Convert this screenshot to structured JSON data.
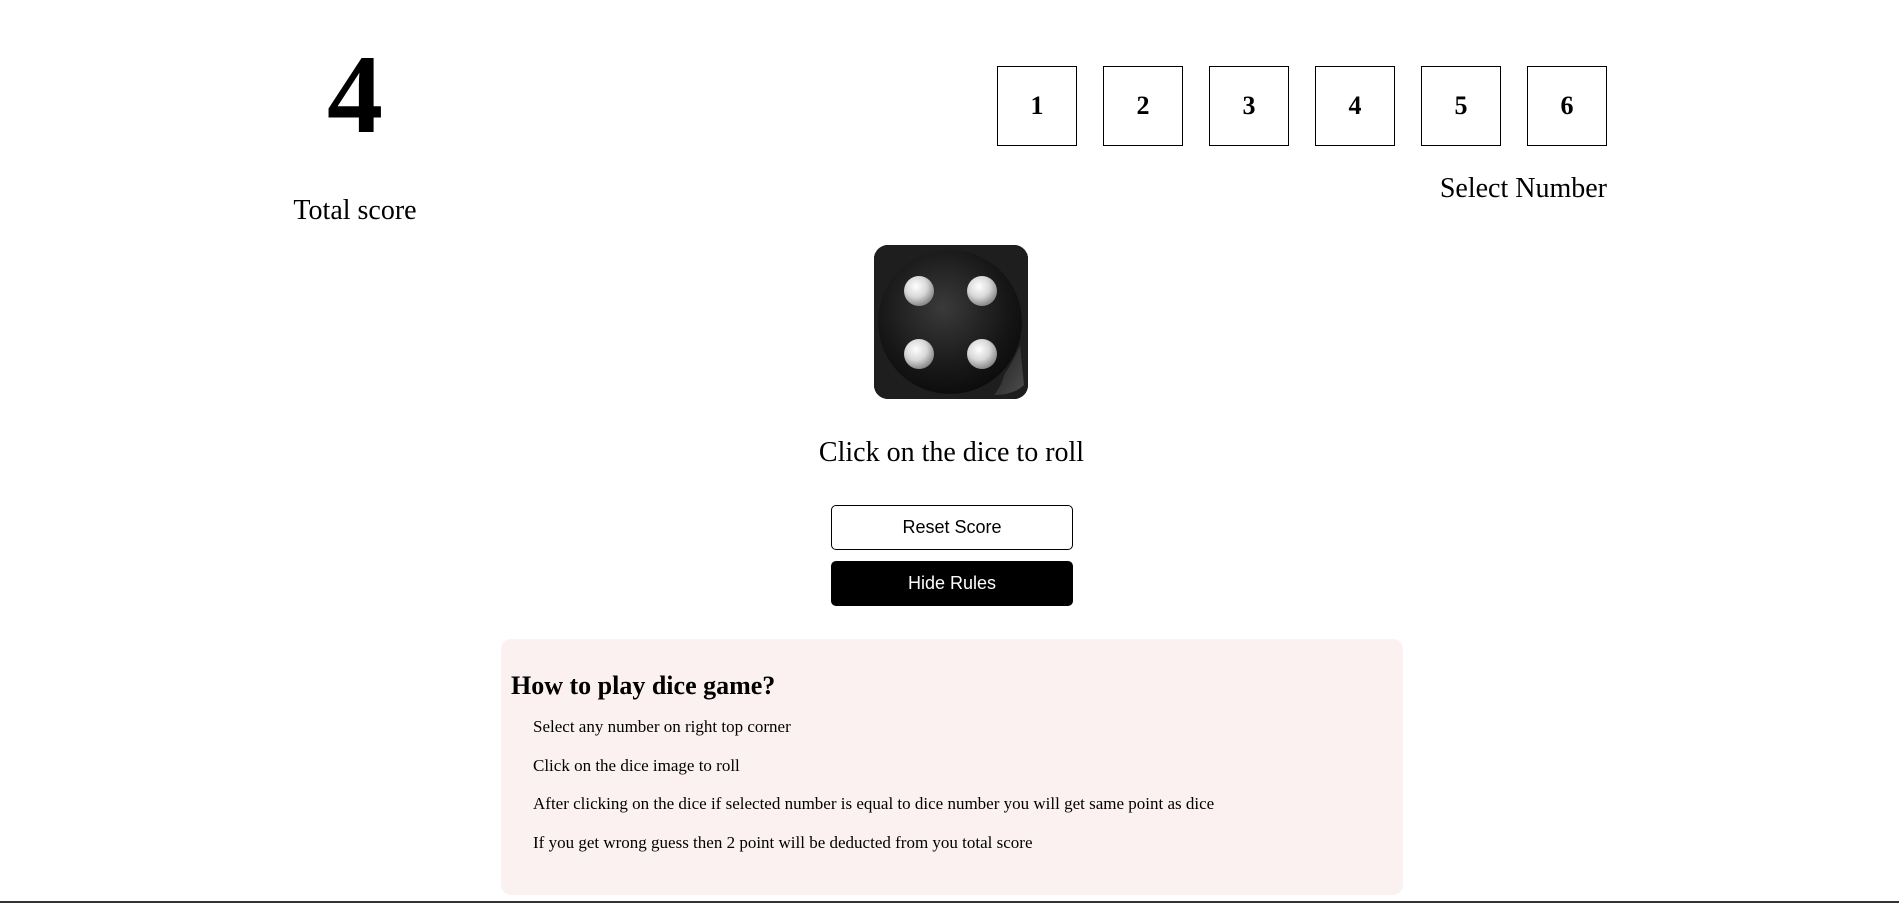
{
  "score": {
    "value": "4",
    "label": "Total score"
  },
  "selector": {
    "numbers": [
      "1",
      "2",
      "3",
      "4",
      "5",
      "6"
    ],
    "label": "Select Number"
  },
  "dice": {
    "face": 4,
    "icon": "dice-face-4-icon"
  },
  "hint": "Click on the dice to roll",
  "buttons": {
    "reset": "Reset Score",
    "rules": "Hide Rules"
  },
  "rules": {
    "title": "How to play dice game?",
    "items": [
      "Select any number on right top corner",
      "Click on the dice image to roll",
      "After clicking on the dice if selected number is equal to dice number you will get same point as dice",
      "If you get wrong guess then 2 point will be deducted from you total score"
    ]
  },
  "colors": {
    "rules_bg": "#fbf1f1",
    "dice_body": "#1c1c1c",
    "accent_button": "#000000"
  }
}
